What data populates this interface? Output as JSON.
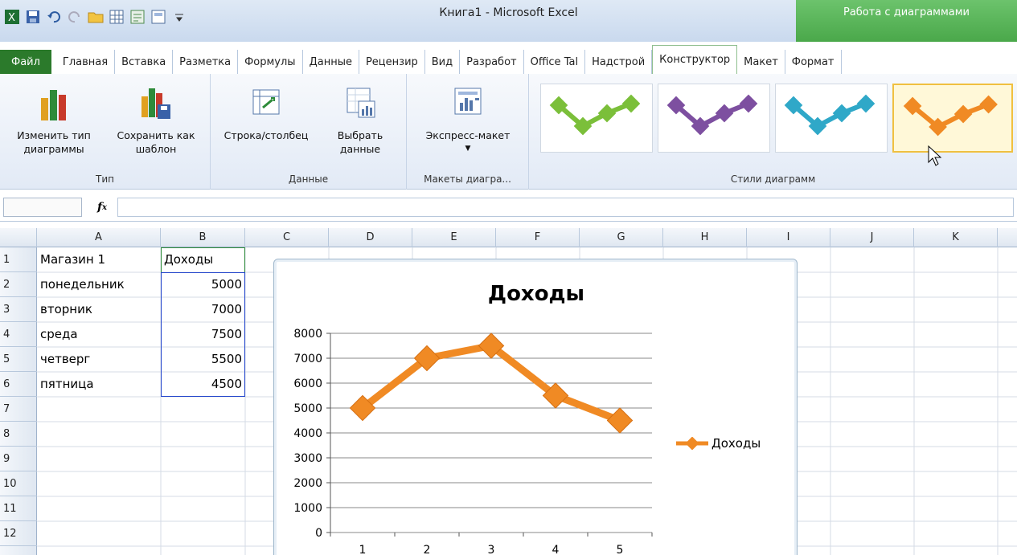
{
  "window": {
    "title": "Книга1  -  Microsoft Excel",
    "context_header": "Работа с диаграммами"
  },
  "tabs": [
    {
      "label": "Файл"
    },
    {
      "label": "Главная"
    },
    {
      "label": "Вставка"
    },
    {
      "label": "Разметка"
    },
    {
      "label": "Формулы"
    },
    {
      "label": "Данные"
    },
    {
      "label": "Рецензир"
    },
    {
      "label": "Вид"
    },
    {
      "label": "Разработ"
    },
    {
      "label": "Office Tal"
    },
    {
      "label": "Надстрой"
    },
    {
      "label": "Конструктор"
    },
    {
      "label": "Макет"
    },
    {
      "label": "Формат"
    }
  ],
  "ribbon": {
    "groups": {
      "type": "Тип",
      "data": "Данные",
      "layouts": "Макеты диагра...",
      "styles": "Стили диаграмм"
    },
    "buttons": {
      "change_type": "Изменить тип диаграммы",
      "save_template": "Сохранить как шаблон",
      "switch_row_col": "Строка/столбец",
      "select_data": "Выбрать данные",
      "quick_layout": "Экспресс-макет"
    },
    "style_colors": [
      "#7bbf3a",
      "#7d4fa0",
      "#2fa8c8",
      "#f08a24"
    ]
  },
  "formula_bar": {
    "fx": "fx",
    "value": ""
  },
  "sheet": {
    "columns": [
      "A",
      "B",
      "C",
      "D",
      "E",
      "F",
      "G",
      "H",
      "I",
      "J",
      "K"
    ],
    "rows": [
      "1",
      "2",
      "3",
      "4",
      "5",
      "6",
      "7",
      "8",
      "9",
      "10",
      "11",
      "12"
    ],
    "cells": {
      "A1": "Магазин 1",
      "B1": "Доходы",
      "A2": "понедельник",
      "B2": "5000",
      "A3": "вторник",
      "B3": "7000",
      "A4": "среда",
      "B4": "7500",
      "A5": "четверг",
      "B5": "5500",
      "A6": "пятница",
      "B6": "4500"
    }
  },
  "chart_data": {
    "type": "line",
    "title": "Доходы",
    "x": [
      1,
      2,
      3,
      4,
      5
    ],
    "series": [
      {
        "name": "Доходы",
        "values": [
          5000,
          7000,
          7500,
          5500,
          4500
        ],
        "color": "#f08a24"
      }
    ],
    "ylim": [
      0,
      8000
    ],
    "yticks": [
      0,
      1000,
      2000,
      3000,
      4000,
      5000,
      6000,
      7000,
      8000
    ],
    "grid": true,
    "legend": "right"
  }
}
